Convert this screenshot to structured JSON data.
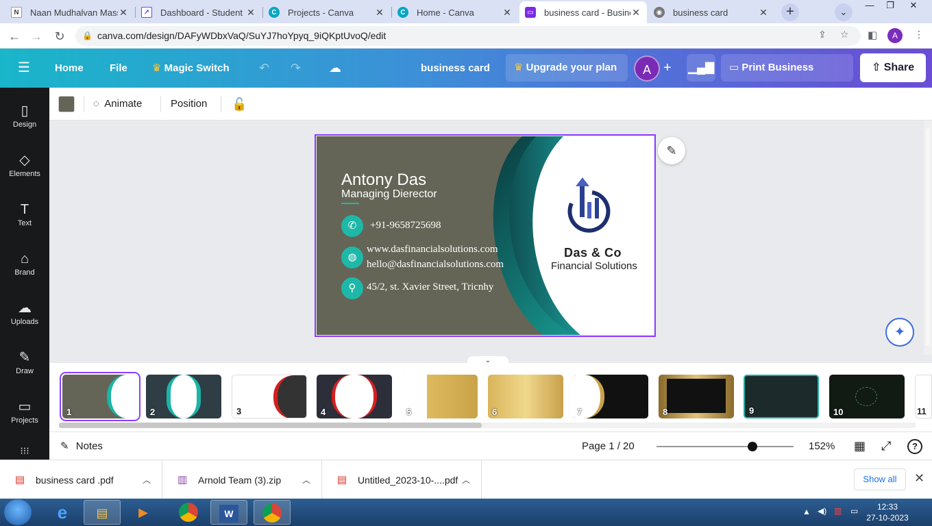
{
  "browser": {
    "tabs": [
      {
        "title": "Naan Mudhalvan Mass",
        "favicon": "naan-mudhalvan-icon",
        "color": "#ffffff"
      },
      {
        "title": "Dashboard - Student",
        "favicon": "dashboard-icon",
        "color": "#6a4cd6"
      },
      {
        "title": "Projects - Canva",
        "favicon": "canva-icon",
        "color": "#00c4cc"
      },
      {
        "title": "Home - Canva",
        "favicon": "canva-icon",
        "color": "#00c4cc"
      },
      {
        "title": "business card - Busine",
        "favicon": "canva-design-icon",
        "color": "#7d2ae8"
      },
      {
        "title": "business card",
        "favicon": "globe-icon",
        "color": "#5f6368"
      }
    ],
    "tab_close": "✕",
    "new_tab": "+",
    "url": "canva.com/design/DAFyWDbxVaQ/SuYJ7hoYpyq_9iQKptUvoQ/edit",
    "profile_initial": "A"
  },
  "canva_header": {
    "menu_icon": "☰",
    "home": "Home",
    "file": "File",
    "magic_switch": "Magic Switch",
    "doc_title": "business card",
    "upgrade": "Upgrade your plan",
    "avatar": "A",
    "plus": "+",
    "print": "Print Business Cards",
    "share": "Share"
  },
  "sidebar": {
    "items": [
      {
        "label": "Design",
        "icon": "▯"
      },
      {
        "label": "Elements",
        "icon": "◇"
      },
      {
        "label": "Text",
        "icon": "T"
      },
      {
        "label": "Brand",
        "icon": "⌂"
      },
      {
        "label": "Uploads",
        "icon": "☁"
      },
      {
        "label": "Draw",
        "icon": "✎"
      },
      {
        "label": "Projects",
        "icon": "▭"
      }
    ]
  },
  "toolbar": {
    "animate": "Animate",
    "position": "Position",
    "swatch_color": "#646556"
  },
  "card": {
    "name": "Antony Das",
    "role": "Managing Dierector",
    "phone": "+91-9658725698",
    "website": "www.dasfinancialsolutions.com",
    "email": "hello@dasfinancialsolutions.com",
    "address": "45/2, st. Xavier Street, Tricnhy",
    "company": "Das & Co",
    "tagline": "Financial Solutions",
    "accent_color": "#1eb8a8",
    "bg_color": "#646556"
  },
  "pages": {
    "thumbnails": [
      {
        "num": "1",
        "style": "gray-teal"
      },
      {
        "num": "2",
        "style": "dark-teal"
      },
      {
        "num": "3",
        "style": "white-red"
      },
      {
        "num": "4",
        "style": "dark-red"
      },
      {
        "num": "5",
        "style": "gold-white"
      },
      {
        "num": "6",
        "style": "gold"
      },
      {
        "num": "7",
        "style": "white-black-gold"
      },
      {
        "num": "8",
        "style": "black-gold"
      },
      {
        "num": "9",
        "style": "dark-teal-2"
      },
      {
        "num": "10",
        "style": "black-green"
      },
      {
        "num": "11",
        "style": "white"
      }
    ]
  },
  "bottom": {
    "notes": "Notes",
    "page_indicator": "Page 1 / 20",
    "zoom": "152%",
    "zoom_fraction": 0.7
  },
  "downloads": [
    {
      "name": "business card .pdf",
      "icon": "pdf-file-icon"
    },
    {
      "name": "Arnold Team (3).zip",
      "icon": "zip-file-icon"
    },
    {
      "name": "Untitled_2023-10-....pdf",
      "icon": "pdf-file-icon"
    }
  ],
  "downloads_show_all": "Show all",
  "taskbar": {
    "apps": [
      "internet-explorer-icon",
      "file-explorer-icon",
      "media-player-icon",
      "chrome-icon",
      "word-icon",
      "chrome-profile-icon"
    ],
    "time": "12:33",
    "date": "27-10-2023"
  }
}
